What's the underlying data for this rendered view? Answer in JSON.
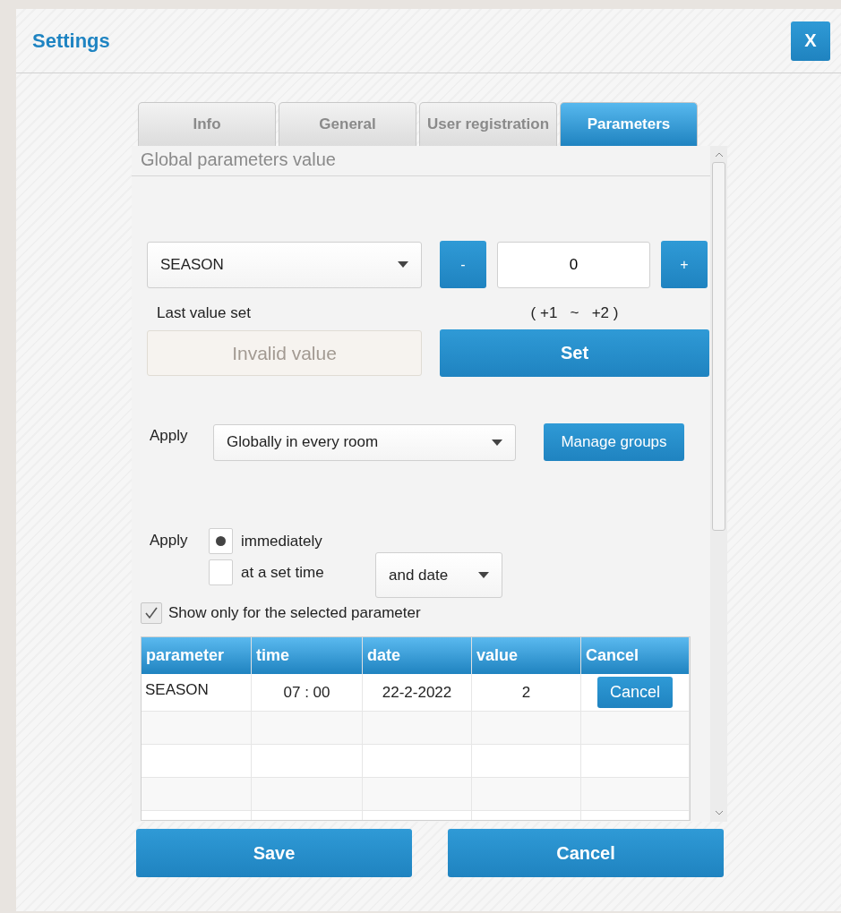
{
  "window": {
    "title": "Settings",
    "close_label": "X"
  },
  "tabs": [
    {
      "label": "Info",
      "selected": false
    },
    {
      "label": "General",
      "selected": false
    },
    {
      "label": "User registration",
      "selected": false
    },
    {
      "label": "Parameters",
      "selected": true
    }
  ],
  "section_title": "Global parameters value",
  "parameter": {
    "value": "SEASON",
    "minus_label": "-",
    "amount": "0",
    "plus_label": "+",
    "last_value_label": "Last value set",
    "last_value": "Invalid value",
    "range": "( +1   ~   +2 )",
    "set_label": "Set"
  },
  "apply_scope": {
    "label": "Apply",
    "value": "Globally in every room",
    "manage_label": "Manage groups"
  },
  "apply_timing": {
    "label": "Apply",
    "options": [
      {
        "label": "immediately",
        "selected": true
      },
      {
        "label": "at a set time",
        "selected": false
      }
    ],
    "date_select": "and date"
  },
  "filter": {
    "label": "Show only for the selected parameter",
    "checked": true
  },
  "table": {
    "columns": [
      "parameter",
      "time",
      "date",
      "value",
      "Cancel"
    ],
    "rows": [
      {
        "parameter": "SEASON",
        "time": "07 : 00",
        "date": "22-2-2022",
        "value": "2",
        "action": "Cancel"
      }
    ]
  },
  "footer": {
    "save_label": "Save",
    "cancel_label": "Cancel"
  }
}
